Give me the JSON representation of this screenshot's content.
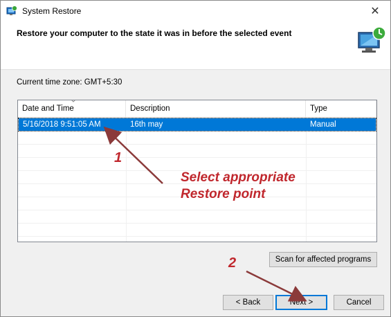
{
  "window": {
    "title": "System Restore",
    "close_glyph": "✕"
  },
  "header": {
    "text": "Restore your computer to the state it was in before the selected event",
    "graphic_icon": "system-restore-icon"
  },
  "timezone_label": "Current time zone: GMT+5:30",
  "table": {
    "columns": [
      "Date and Time",
      "Description",
      "Type"
    ],
    "rows": [
      {
        "date": "5/16/2018 9:51:05 AM",
        "description": "16th may",
        "type": "Manual",
        "selected": true
      }
    ]
  },
  "buttons": {
    "scan": "Scan for affected programs",
    "back": "< Back",
    "next": "Next >",
    "cancel": "Cancel"
  },
  "annotations": {
    "step1": "1",
    "step2": "2",
    "instruction_line1": "Select appropriate",
    "instruction_line2": "Restore point",
    "color": "#c0272d"
  },
  "colors": {
    "selection": "#0078d7",
    "window_bg": "#f0f0f0",
    "arrow": "#8b3a3a"
  }
}
